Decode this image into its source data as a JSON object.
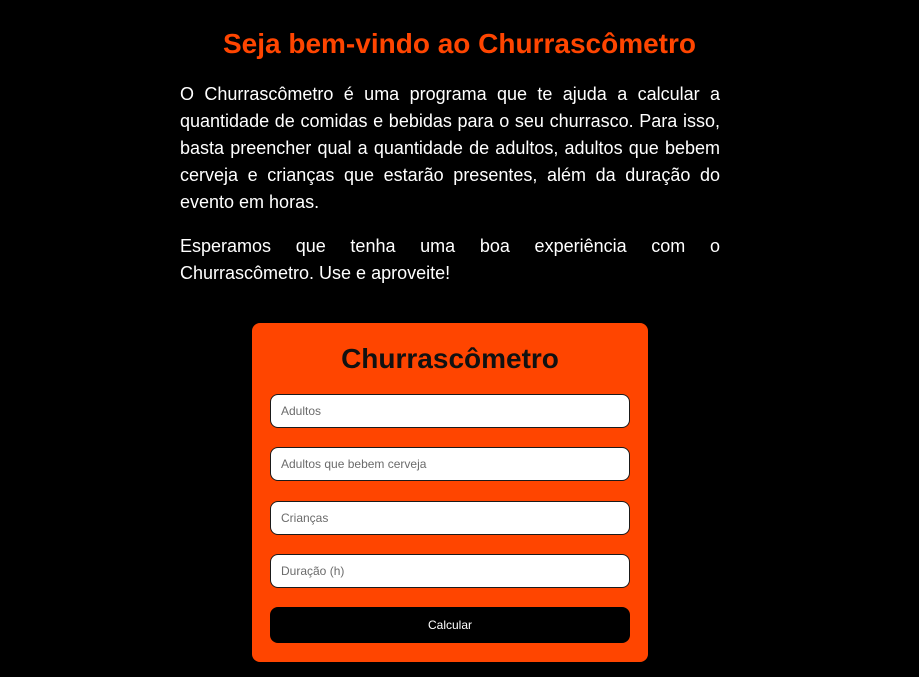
{
  "header": {
    "title": "Seja bem-vindo ao Churrascômetro"
  },
  "intro": {
    "paragraph_1": "O Churrascômetro é uma programa que te ajuda a calcular a quantidade de comidas e bebidas para o seu churrasco. Para isso, basta preencher qual a quantidade de adultos, adultos que bebem cerveja e crianças que estarão presentes, além da duração do evento em horas.",
    "paragraph_2": "Esperamos que tenha uma boa experiência com o Churrascômetro. Use e aproveite!"
  },
  "form": {
    "title": "Churrascômetro",
    "fields": [
      {
        "placeholder": "Adultos",
        "value": ""
      },
      {
        "placeholder": "Adultos que bebem cerveja",
        "value": ""
      },
      {
        "placeholder": "Crianças",
        "value": ""
      },
      {
        "placeholder": "Duração (h)",
        "value": ""
      }
    ],
    "submit_label": "Calcular"
  },
  "colors": {
    "background": "#000000",
    "accent": "#ff4500",
    "button": "#000000",
    "button_text": "#ffffff",
    "body_text": "#ffffff"
  }
}
